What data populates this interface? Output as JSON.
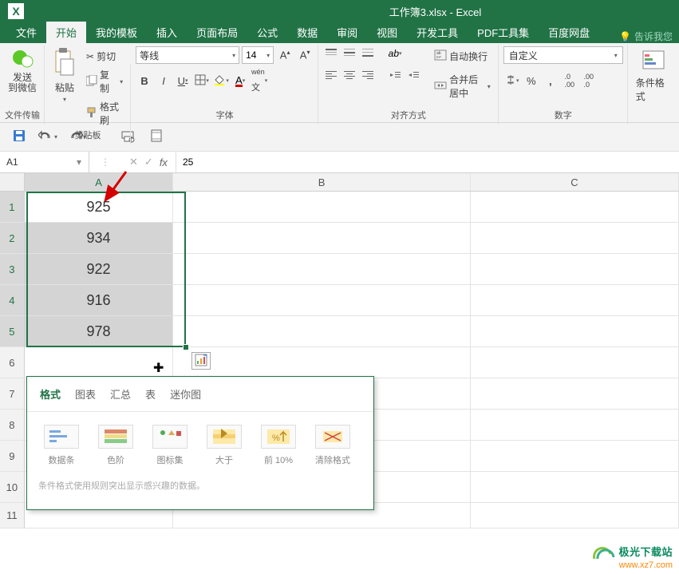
{
  "app": {
    "window_title": "工作簿3.xlsx - Excel"
  },
  "tabs": {
    "file": "文件",
    "home": "开始",
    "templates": "我的模板",
    "insert": "插入",
    "page_layout": "页面布局",
    "formulas": "公式",
    "data": "数据",
    "review": "审阅",
    "view": "视图",
    "developer": "开发工具",
    "pdf_tools": "PDF工具集",
    "baidu": "百度网盘",
    "tell_me": "告诉我您"
  },
  "ribbon": {
    "send_wechat": "发送\n到微信",
    "wechat_group": "文件传输",
    "paste": "粘贴",
    "cut": "剪切",
    "copy": "复制",
    "format_painter": "格式刷",
    "clipboard_group": "剪贴板",
    "font_name": "等线",
    "font_size": "14",
    "font_group": "字体",
    "wrap_text": "自动换行",
    "merge_center": "合并后居中",
    "alignment_group": "对齐方式",
    "number_format": "自定义",
    "number_group": "数字",
    "cond_format": "条件格式"
  },
  "formula_bar": {
    "name_box": "A1",
    "formula_value": "25"
  },
  "columns": {
    "a": "A",
    "b": "B",
    "c": "C"
  },
  "rows": [
    "1",
    "2",
    "3",
    "4",
    "5",
    "6",
    "7",
    "8",
    "9",
    "10",
    "11"
  ],
  "cells": {
    "a1": "925",
    "a2": "934",
    "a3": "922",
    "a4": "916",
    "a5": "978"
  },
  "quick_analysis": {
    "tabs": {
      "format": "格式",
      "chart": "图表",
      "totals": "汇总",
      "tables": "表",
      "sparklines": "迷你图"
    },
    "options": {
      "data_bars": "数据条",
      "color_scale": "色阶",
      "icon_set": "图标集",
      "greater_than": "大于",
      "top_10": "前 10%",
      "clear_format": "清除格式"
    },
    "hint": "条件格式使用规则突出显示感兴趣的数据。"
  },
  "watermark": {
    "name": "极光下载站",
    "domain": "www.xz7.com"
  }
}
